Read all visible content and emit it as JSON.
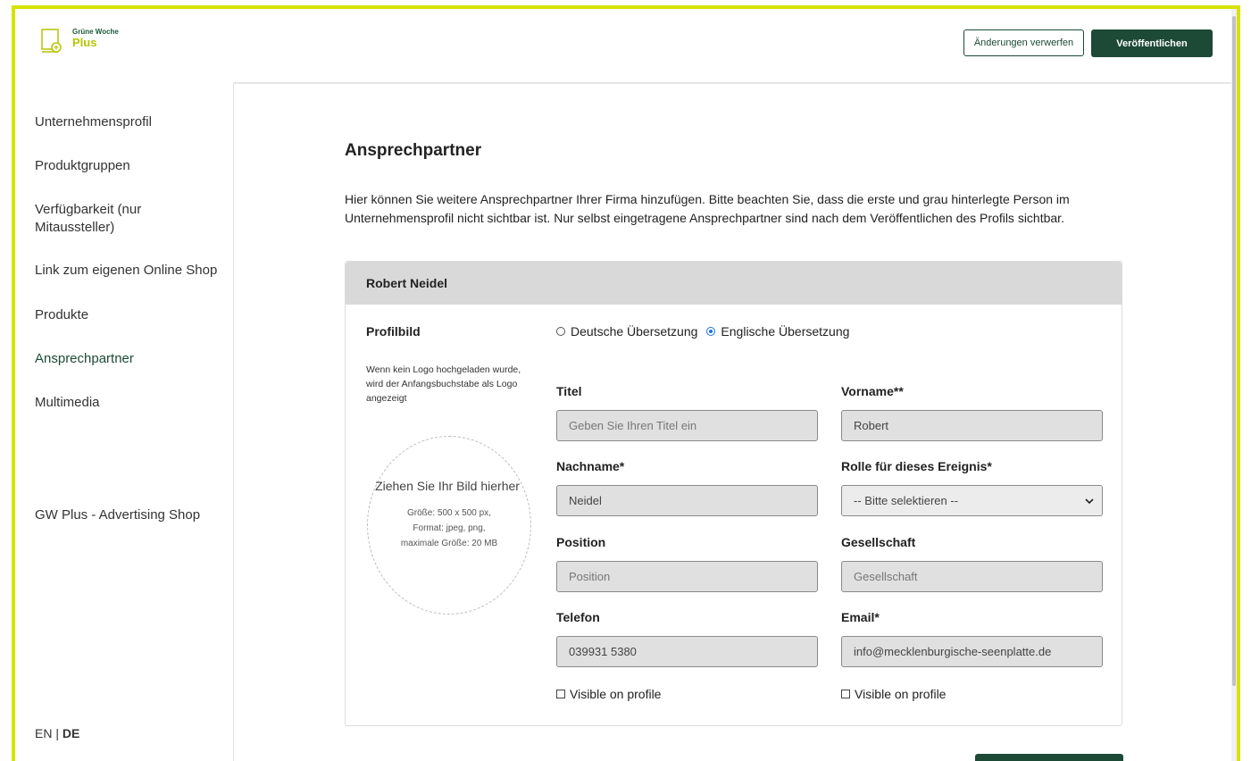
{
  "brand": {
    "line1": "Grüne Woche",
    "line2": "Plus",
    "accent": "#b7c400",
    "primary": "#1d4a36"
  },
  "sidebar": {
    "items": [
      {
        "label": "Unternehmensprofil"
      },
      {
        "label": "Produktgruppen"
      },
      {
        "label": "Verfügbarkeit (nur Mitaussteller)"
      },
      {
        "label": "Link zum eigenen Online Shop"
      },
      {
        "label": "Produkte"
      },
      {
        "label": "Ansprechpartner"
      },
      {
        "label": "Multimedia"
      },
      {
        "label": "GW Plus - Advertising Shop"
      }
    ],
    "lang_en": "EN",
    "lang_sep": " | ",
    "lang_de": "DE"
  },
  "header": {
    "discard_label": "Änderungen verwerfen",
    "publish_label": "Veröffentlichen"
  },
  "main": {
    "title": "Ansprechpartner",
    "intro": "Hier können Sie weitere Ansprechpartner Ihrer Firma hinzufügen. Bitte beachten Sie, dass die erste und grau hinterlegte Person im Unternehmensprofil nicht sichtbar ist. Nur selbst eingetragene Ansprechpartner sind nach dem Veröffentlichen des Profils sichtbar."
  },
  "contact": {
    "name": "Robert Neidel",
    "profile_label": "Profilbild",
    "profile_hint": "Wenn kein Logo hochgeladen wurde, wird der Anfangsbuchstabe als Logo angezeigt",
    "dropzone_title": "Ziehen Sie Ihr Bild hierher",
    "dropzone_info": "Größe: 500 x 500 px, Format: jpeg, png, maximale Größe: 20 MB",
    "radio_de": "Deutsche Übersetzung",
    "radio_en": "Englische Übersetzung",
    "fields": {
      "titel_label": "Titel",
      "titel_placeholder": "Geben Sie Ihren Titel ein",
      "vorname_label": "Vorname**",
      "vorname_value": "Robert",
      "nachname_label": "Nachname*",
      "nachname_value": "Neidel",
      "rolle_label": "Rolle für dieses Ereignis*",
      "rolle_value": "-- Bitte selektieren --",
      "position_label": "Position",
      "position_placeholder": "Position",
      "gesellschaft_label": "Gesellschaft",
      "gesellschaft_placeholder": "Gesellschaft",
      "telefon_label": "Telefon",
      "telefon_value": "039931 5380",
      "email_label": "Email*",
      "email_value": "info@mecklenburgische-seenplatte.de"
    },
    "visible_label": "Visible on profile"
  }
}
